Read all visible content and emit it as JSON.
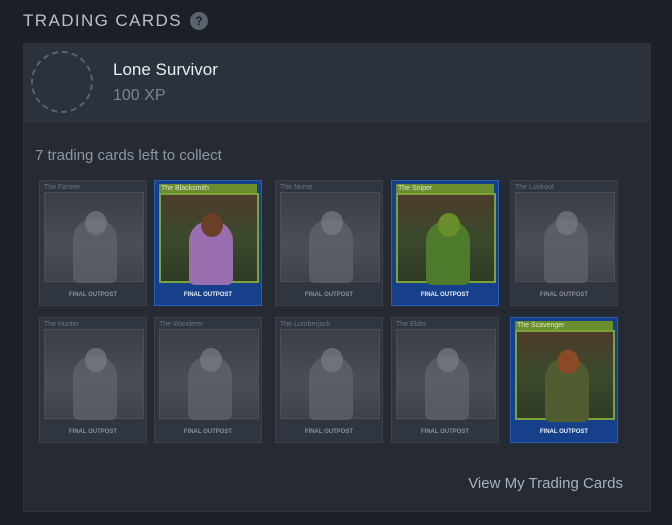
{
  "header": {
    "title": "TRADING CARDS",
    "help_icon": "question-icon",
    "help_glyph": "?"
  },
  "badge": {
    "name": "Lone Survivor",
    "xp": "100 XP"
  },
  "status": {
    "cards_left": "7 trading cards left to collect"
  },
  "cards": [
    {
      "name": "The Farmer",
      "owned": false
    },
    {
      "name": "The Blacksmith",
      "owned": true
    },
    {
      "name": "The Nurse",
      "owned": false
    },
    {
      "name": "The Sniper",
      "owned": true
    },
    {
      "name": "The Lookout",
      "owned": false
    },
    {
      "name": "The Hunter",
      "owned": false
    },
    {
      "name": "The Wanderer",
      "owned": false
    },
    {
      "name": "The Lumberjack",
      "owned": false
    },
    {
      "name": "The Elder",
      "owned": false
    },
    {
      "name": "The Scavenger",
      "owned": true
    }
  ],
  "card_logo": "FINAL OUTPOST",
  "footer": {
    "view_link": "View My Trading Cards"
  },
  "colors": {
    "owned_card_bg": "#16418a",
    "owned_label_bg": "#6b8e2f"
  }
}
